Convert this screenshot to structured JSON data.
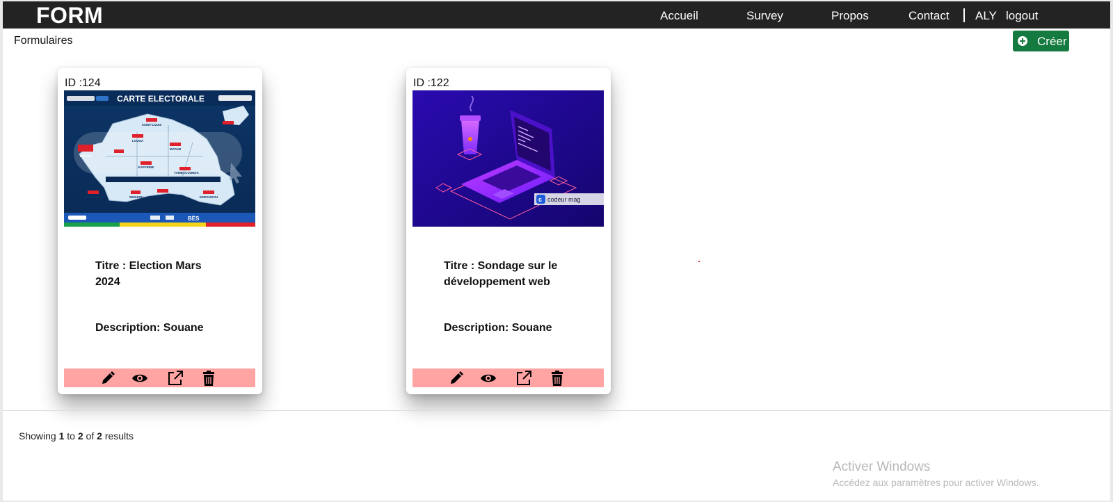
{
  "nav": {
    "brand": "FORM",
    "links": [
      "Accueil",
      "Survey",
      "Propos",
      "Contact"
    ],
    "user": "ALY",
    "logout": "logout"
  },
  "page": {
    "heading": "Formulaires",
    "create_label": "Créer"
  },
  "cards": [
    {
      "id_label": "ID :124",
      "title": "Titre : Election Mars 2024",
      "description": "Description: Souane",
      "image": {
        "title": "CARTE ELECTORALE",
        "left_logo": "www.emedia.sn",
        "right_logo": "emediaDIGITAL",
        "regions": [
          "SAINT-LOUIS",
          "LOUGA",
          "MATAM",
          "KAFFRINE",
          "TAMBACOUNDA",
          "ZIGUINCHOR",
          "SEDHIOU",
          "KOLDA",
          "KEDOUGOU",
          "DAKAR"
        ],
        "footer": "BÈS",
        "accent": "#e0202a"
      },
      "actions": [
        "edit-icon",
        "view-icon",
        "open-external-icon",
        "delete-icon"
      ]
    },
    {
      "id_label": "ID :122",
      "title": "Titre : Sondage sur le développement web",
      "description": "Description: Souane",
      "image": {
        "badge": "codeur mag",
        "accent": "#6a1bff"
      },
      "actions": [
        "edit-icon",
        "view-icon",
        "open-external-icon",
        "delete-icon"
      ]
    }
  ],
  "pagination": {
    "prefix": "Showing",
    "from": "1",
    "to_word": "to",
    "to": "2",
    "of_word": "of",
    "total": "2",
    "suffix": "results"
  },
  "watermark": {
    "line1": "Activer Windows",
    "line2": "Accédez aux paramètres pour activer Windows."
  },
  "colors": {
    "navbar": "#232323",
    "create_button": "#157a3f",
    "action_bar": "#ffa3a3"
  }
}
